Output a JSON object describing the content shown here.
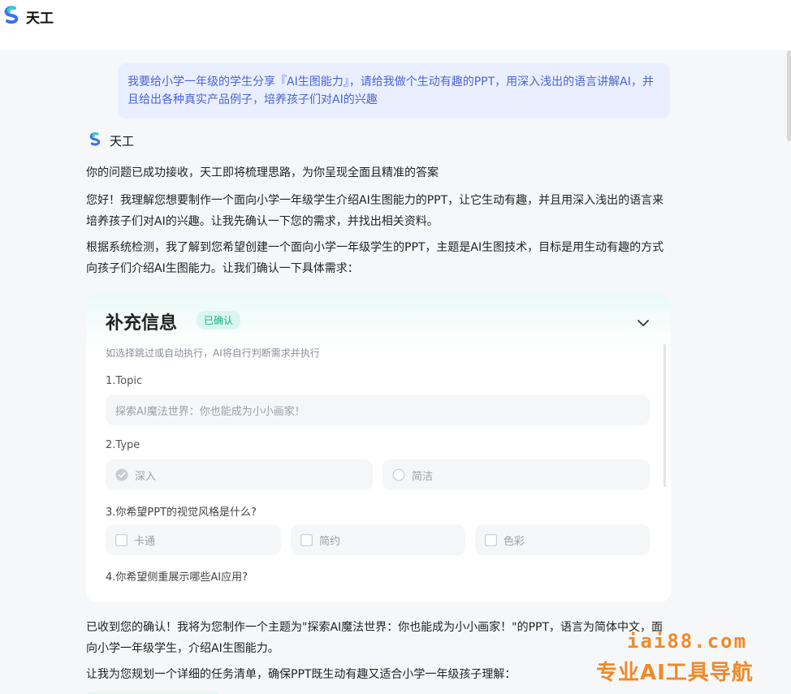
{
  "app": {
    "title": "天工"
  },
  "conversation": {
    "user_message": "我要给小学一年级的学生分享『AI生图能力』，请给我做个生动有趣的PPT，用深入浅出的语言讲解AI，并且给出各种真实产品例子，培养孩子们对AI的兴趣",
    "bot_name": "天工",
    "paragraphs": [
      "你的问题已成功接收，天工即将梳理思路，为你呈现全面且精准的答案",
      "您好！我理解您想要制作一个面向小学一年级学生介绍AI生图能力的PPT，让它生动有趣，并且用深入浅出的语言来培养孩子们对AI的兴趣。让我先确认一下您的需求，并找出相关资料。",
      "根据系统检测，我了解到您希望创建一个面向小学一年级学生的PPT，主题是AI生图技术，目标是用生动有趣的方式向孩子们介绍AI生图能力。让我们确认一下具体需求："
    ],
    "after_paragraphs": [
      "已收到您的确认！我将为您制作一个主题为\"探索AI魔法世界：你也能成为小小画家！\"的PPT，语言为简体中文，面向小学一年级学生，介绍AI生图能力。",
      "让我为您规划一个详细的任务清单，确保PPT既生动有趣又适合小学一年级孩子理解："
    ]
  },
  "info_card": {
    "title": "补充信息",
    "badge": "已确认",
    "hint": "如选择跳过或自动执行，AI将自行判断需求并执行",
    "q1_label": "1.Topic",
    "q1_value": "探索AI魔法世界：你也能成为小小画家！",
    "q2_label": "2.Type",
    "q2_options": [
      "深入",
      "简洁"
    ],
    "q3_label": "3.你希望PPT的视觉风格是什么?",
    "q3_options": [
      "卡通",
      "简约",
      "色彩"
    ],
    "q4_label": "4.你希望侧重展示哪些AI应用?"
  },
  "watermark": {
    "domain": "iai88.com",
    "slogan": "专业AI工具导航"
  },
  "colors": {
    "accent_blue": "#4a64d8",
    "badge_green": "#19b184",
    "watermark_orange": "#ee8a2a"
  }
}
